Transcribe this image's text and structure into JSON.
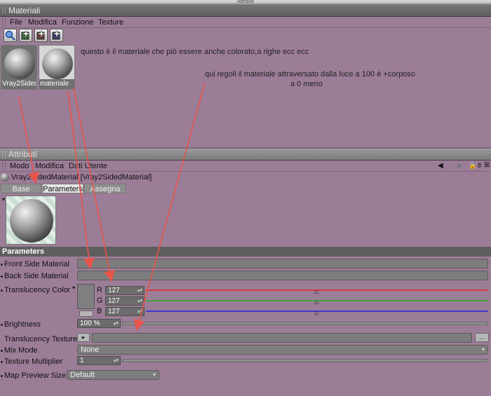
{
  "window": {
    "title": "Attributi"
  },
  "materials_panel": {
    "title": "Materiali",
    "menu": [
      "File",
      "Modifica",
      "Funzione",
      "Texture"
    ],
    "toolbar": [
      "search-icon",
      "new-material-icon",
      "new-material-icon",
      "new-material-icon"
    ],
    "materials": [
      {
        "name": "Vray2SidedMaterial",
        "label": "Vray2Sided"
      },
      {
        "name": "materiale",
        "label": "materiale"
      }
    ],
    "notes": [
      "questo è il materiale che piò essere anche colorato,a righe ecc ecc",
      "qui regoli il materiale attraversato dalla luce a 100 è +corposo",
      "a 0 meno"
    ]
  },
  "attributes_panel": {
    "title": "Attributi",
    "menu": [
      "Modo",
      "Modifica",
      "Dati Utente"
    ],
    "object_title": "Vray2SidedMaterial [Vray2SidedMaterial]",
    "tabs": [
      "Base",
      "Parameters",
      "Assegna"
    ],
    "active_tab": "Parameters",
    "section": "Parameters",
    "params": {
      "front_side_material": "Front Side Material",
      "back_side_material": "Back Side Material",
      "translucency_color": "Translucency Color",
      "brightness": "Brightness",
      "translucency_texture": "Translucency Texture",
      "mix_mode": "Mix Mode",
      "texture_multiplier": "Texture Multiplier",
      "map_preview_size": "Map Preview Size"
    },
    "rgb": [
      {
        "channel": "R",
        "value": "127",
        "color": "#d43c3c",
        "level": 0.5
      },
      {
        "channel": "G",
        "value": "127",
        "color": "#3da43d",
        "level": 0.5
      },
      {
        "channel": "B",
        "value": "127",
        "color": "#3c3ccf",
        "level": 0.5
      }
    ],
    "brightness_value": "100 %",
    "mix_mode_value": "None",
    "texture_multiplier_value": "1",
    "map_preview_size_value": "Default",
    "more_button": "..."
  },
  "annotation_color": "#e9544a"
}
